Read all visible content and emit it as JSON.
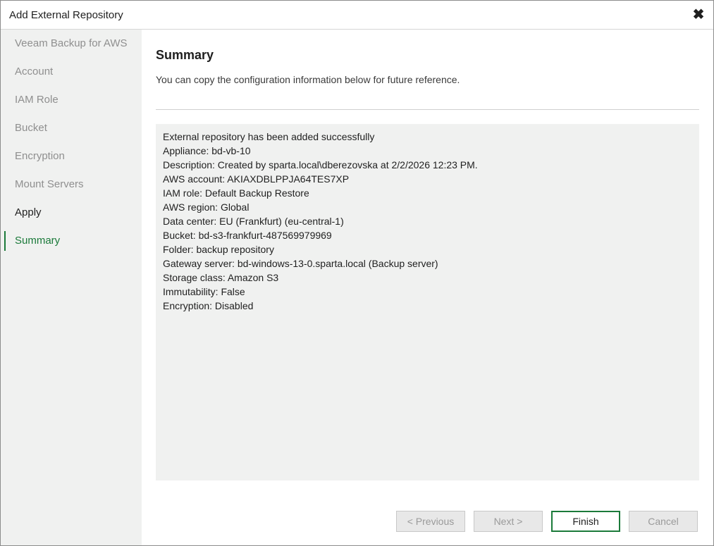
{
  "window": {
    "title": "Add External Repository"
  },
  "sidebar": {
    "items": [
      {
        "label": "Veeam Backup for AWS",
        "state": "disabled"
      },
      {
        "label": "Account",
        "state": "disabled"
      },
      {
        "label": "IAM Role",
        "state": "disabled"
      },
      {
        "label": "Bucket",
        "state": "disabled"
      },
      {
        "label": "Encryption",
        "state": "disabled"
      },
      {
        "label": "Mount Servers",
        "state": "disabled"
      },
      {
        "label": "Apply",
        "state": "done"
      },
      {
        "label": "Summary",
        "state": "active"
      }
    ]
  },
  "main": {
    "title": "Summary",
    "subtitle": "You can copy the configuration information below for future reference.",
    "summary_lines": [
      "External repository has been added successfully",
      "Appliance: bd-vb-10",
      "Description: Created by sparta.local\\dberezovska at 2/2/2026 12:23 PM.",
      "AWS account: AKIAXDBLPPJA64TES7XP",
      "IAM role: Default Backup Restore",
      "AWS region: Global",
      "Data center: EU (Frankfurt) (eu-central-1)",
      "Bucket: bd-s3-frankfurt-487569979969",
      "Folder: backup repository",
      "Gateway server: bd-windows-13-0.sparta.local (Backup server)",
      "Storage class: Amazon S3",
      "Immutability: False",
      "Encryption: Disabled"
    ]
  },
  "buttons": {
    "previous": "< Previous",
    "next": "Next >",
    "finish": "Finish",
    "cancel": "Cancel"
  },
  "icons": {
    "close": "close-icon"
  },
  "colors": {
    "accent": "#1b7a3a",
    "sidebar_bg": "#f0f1f0",
    "summary_bg": "#f0f1f0"
  }
}
